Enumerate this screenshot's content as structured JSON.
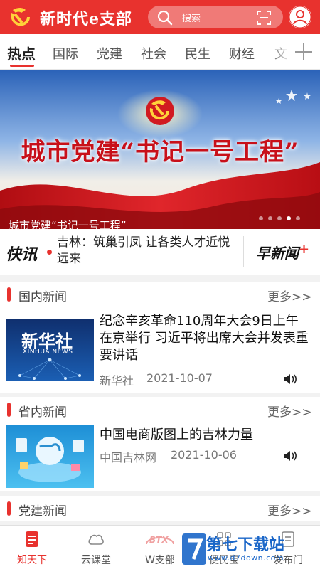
{
  "header": {
    "app_title": "新时代e支部",
    "search_placeholder": "搜索",
    "brand_color": "#e8322e"
  },
  "tabs": [
    {
      "label": "热点",
      "active": true
    },
    {
      "label": "国际",
      "active": false
    },
    {
      "label": "党建",
      "active": false
    },
    {
      "label": "社会",
      "active": false
    },
    {
      "label": "民生",
      "active": false
    },
    {
      "label": "财经",
      "active": false
    },
    {
      "label": "文",
      "active": false
    }
  ],
  "banner": {
    "headline": "城市党建“书记一号工程”",
    "caption": "城市党建“书记一号工程”",
    "slide_count": 5,
    "active_slide": 4
  },
  "flash": {
    "logo": "快讯",
    "text": "吉林：筑巢引凤 让各类人才近悦远来",
    "morning_news": "早新闻",
    "morning_plus": "+"
  },
  "sections": [
    {
      "title": "国内新闻",
      "more": "更多>>",
      "item": {
        "title": "纪念辛亥革命110周年大会9日上午在京举行 习近平将出席大会并发表重要讲话",
        "source": "新华社",
        "date": "2021-10-07",
        "thumb_text": "新华社",
        "thumb_sub": "XINHUA NEWS"
      }
    },
    {
      "title": "省内新闻",
      "more": "更多>>",
      "item": {
        "title": "中国电商版图上的吉林力量",
        "source": "中国吉林网",
        "date": "2021-10-06"
      }
    },
    {
      "title": "党建新闻",
      "more": "更多>>"
    }
  ],
  "bottom_nav": [
    {
      "label": "知天下",
      "icon": "document-icon",
      "active": true
    },
    {
      "label": "云课堂",
      "icon": "cloud-icon",
      "active": false
    },
    {
      "label": "W支部",
      "icon": "btx-icon",
      "btx": "BTX",
      "active": false
    },
    {
      "label": "便民宝",
      "icon": "grid-icon",
      "active": false
    },
    {
      "label": "发布门",
      "icon": "publish-icon",
      "active": false
    }
  ],
  "watermark": {
    "text": "第七下载站",
    "url": "www.d7down.com"
  }
}
